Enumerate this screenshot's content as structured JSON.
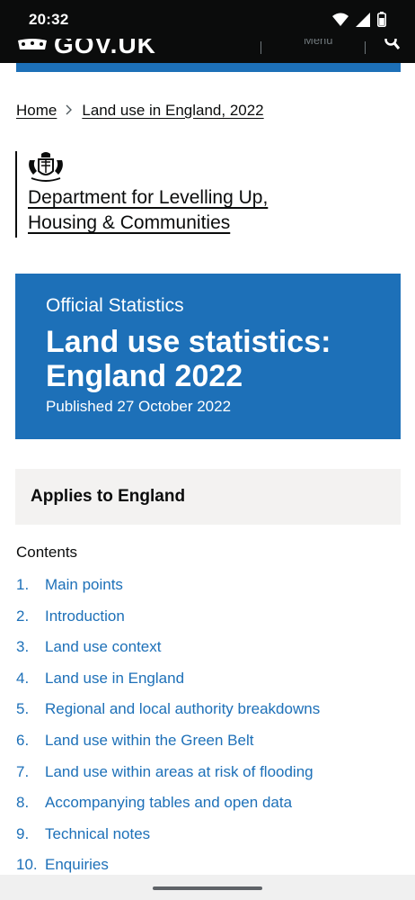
{
  "status_bar": {
    "time": "20:32",
    "icons": [
      "wifi-icon",
      "signal-icon",
      "battery-icon"
    ]
  },
  "header": {
    "logo_text": "GOV.UK",
    "menu_text": "Menu",
    "search_icon": "search-icon"
  },
  "breadcrumb": {
    "items": [
      "Home",
      "Land use in England, 2022"
    ]
  },
  "organisation": {
    "crest_icon": "royal-crest-icon",
    "name": "Department for Levelling Up, Housing & Communities"
  },
  "hero": {
    "kicker": "Official Statistics",
    "title": "Land use statistics: England 2022",
    "published": "Published 27 October 2022"
  },
  "applies": {
    "text": "Applies to England"
  },
  "contents": {
    "heading": "Contents",
    "items": [
      {
        "num": "1.",
        "label": "Main points"
      },
      {
        "num": "2.",
        "label": "Introduction"
      },
      {
        "num": "3.",
        "label": "Land use context"
      },
      {
        "num": "4.",
        "label": "Land use in England"
      },
      {
        "num": "5.",
        "label": "Regional and local authority breakdowns"
      },
      {
        "num": "6.",
        "label": "Land use within the Green Belt"
      },
      {
        "num": "7.",
        "label": "Land use within areas at risk of flooding"
      },
      {
        "num": "8.",
        "label": "Accompanying tables and open data"
      },
      {
        "num": "9.",
        "label": "Technical notes"
      },
      {
        "num": "10.",
        "label": "Enquiries"
      }
    ]
  },
  "colors": {
    "brand_blue": "#1d70b8",
    "text": "#0b0c0c",
    "panel_grey": "#f3f2f1"
  }
}
